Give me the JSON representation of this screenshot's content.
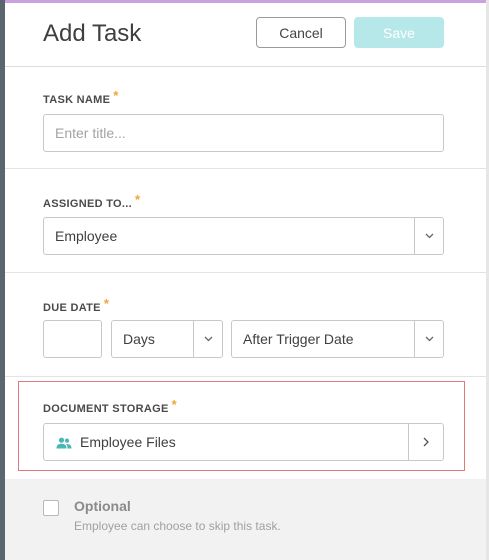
{
  "header": {
    "title": "Add Task",
    "cancel_label": "Cancel",
    "save_label": "Save"
  },
  "task_name": {
    "label": "TASK NAME",
    "required_mark": "*",
    "placeholder": "Enter title...",
    "value": ""
  },
  "assigned_to": {
    "label": "ASSIGNED TO...",
    "required_mark": "*",
    "value": "Employee"
  },
  "due_date": {
    "label": "DUE DATE",
    "required_mark": "*",
    "number_value": "",
    "unit_value": "Days",
    "trigger_value": "After Trigger Date"
  },
  "document_storage": {
    "label": "DOCUMENT STORAGE",
    "required_mark": "*",
    "value": "Employee Files",
    "icon": "people-icon"
  },
  "optional": {
    "title": "Optional",
    "description": "Employee can choose to skip this task.",
    "checked": false
  },
  "colors": {
    "accent_top": "#c9a2df",
    "save_disabled": "#b6e8ea",
    "required": "#f0a43a",
    "highlight_border": "#e07a7a",
    "icon_teal": "#4ab7b4"
  }
}
